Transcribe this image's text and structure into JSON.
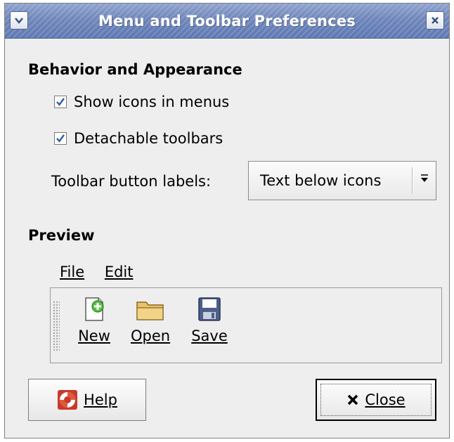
{
  "window": {
    "title": "Menu and Toolbar Preferences"
  },
  "titlebar": {
    "menu_icon": "chevron-down-icon",
    "close_icon": "close-icon"
  },
  "behavior": {
    "heading": "Behavior and Appearance",
    "show_icons_label": "Show icons in menus",
    "show_icons_checked": true,
    "detachable_label": "Detachable toolbars",
    "detachable_checked": true,
    "labels_label": "Toolbar button labels:",
    "labels_value": "Text below icons"
  },
  "preview": {
    "heading": "Preview",
    "menu": {
      "file": "File",
      "edit": "Edit"
    },
    "tools": [
      {
        "label": "New",
        "icon": "new-document-icon"
      },
      {
        "label": "Open",
        "icon": "open-folder-icon"
      },
      {
        "label": "Save",
        "icon": "floppy-disk-icon"
      }
    ]
  },
  "buttons": {
    "help": "Help",
    "close": "Close"
  },
  "colors": {
    "titlebar": "#6f86bb",
    "dialog_bg": "#eeeeee",
    "check_mark": "#2b5fa7"
  }
}
